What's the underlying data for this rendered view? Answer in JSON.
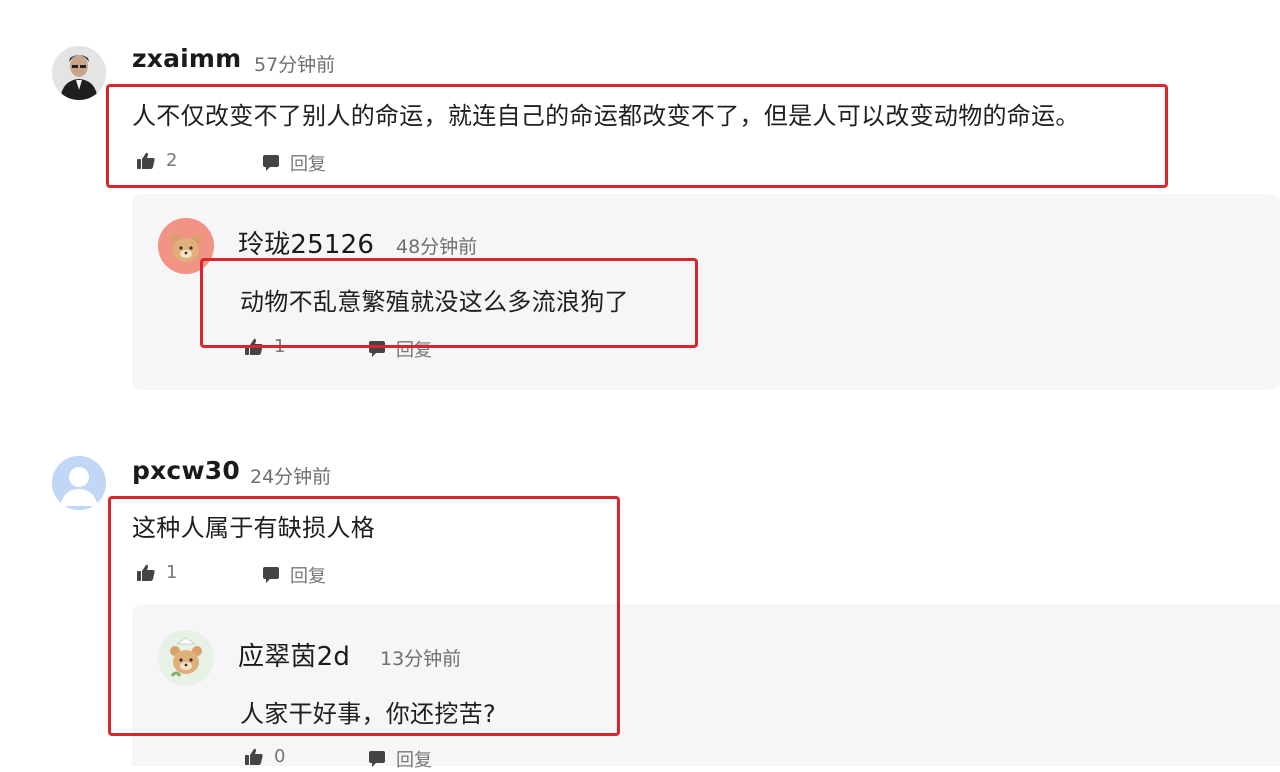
{
  "colors": {
    "highlight": "#d9262a",
    "panel": "#f6f6f8"
  },
  "comments": [
    {
      "username": "zxaimm",
      "time": "57分钟前",
      "content": "人不仅改变不了别人的命运，就连自己的命运都改变不了，但是人可以改变动物的命运。",
      "likes": "2",
      "reply_label": "回复",
      "replies": [
        {
          "username": "玲珑25126",
          "time": "48分钟前",
          "content": "动物不乱意繁殖就没这么多流浪狗了",
          "likes": "1",
          "reply_label": "回复"
        }
      ]
    },
    {
      "username": "pxcw30",
      "time": "24分钟前",
      "content": "这种人属于有缺损人格",
      "likes": "1",
      "reply_label": "回复",
      "replies": [
        {
          "username": "应翠茵2d",
          "time": "13分钟前",
          "content": "人家干好事，你还挖苦?",
          "likes": "0",
          "reply_label": "回复"
        }
      ]
    }
  ],
  "icons": {
    "like": "thumbs-up-icon",
    "reply": "speech-bubble-icon"
  }
}
